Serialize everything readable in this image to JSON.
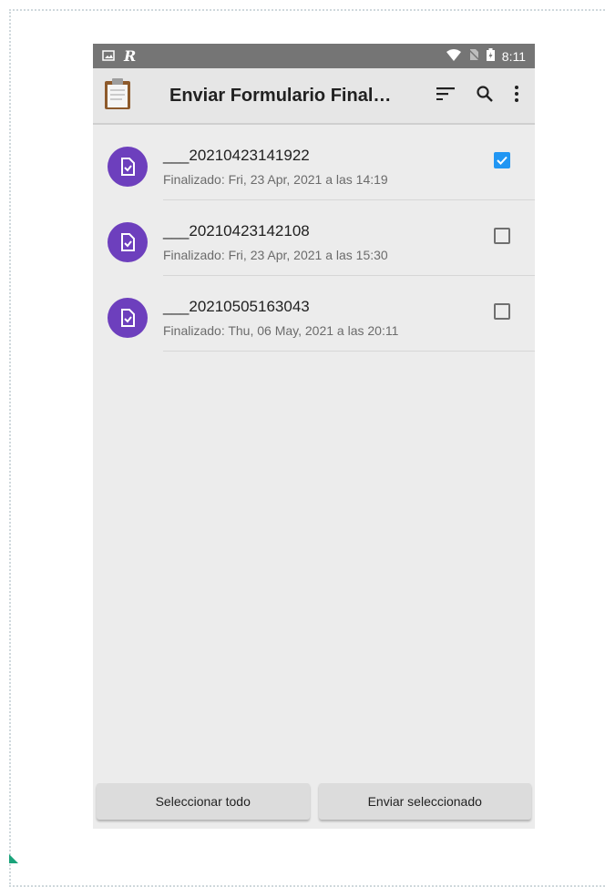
{
  "status_bar": {
    "time": "8:11",
    "left_icons": [
      "image-icon",
      "r-app-icon"
    ],
    "right_icons": [
      "wifi-icon",
      "no-sim-icon",
      "battery-icon"
    ]
  },
  "app_bar": {
    "title": "Enviar Formulario Final…",
    "icon": "clipboard-icon",
    "actions": [
      "sort-icon",
      "search-icon",
      "more-vert-icon"
    ]
  },
  "forms": [
    {
      "name": "___20210423141922",
      "subtitle": "Finalizado: Fri, 23 Apr, 2021 a las 14:19",
      "checked": true
    },
    {
      "name": "___20210423142108",
      "subtitle": "Finalizado: Fri, 23 Apr, 2021 a las 15:30",
      "checked": false
    },
    {
      "name": "___20210505163043",
      "subtitle": "Finalizado: Thu, 06 May, 2021 a las 20:11",
      "checked": false
    }
  ],
  "buttons": {
    "select_all": "Seleccionar todo",
    "send_selected": "Enviar seleccionado"
  },
  "colors": {
    "accent": "#2196f3",
    "avatar": "#6d3fbd",
    "status_bar": "#757575"
  }
}
